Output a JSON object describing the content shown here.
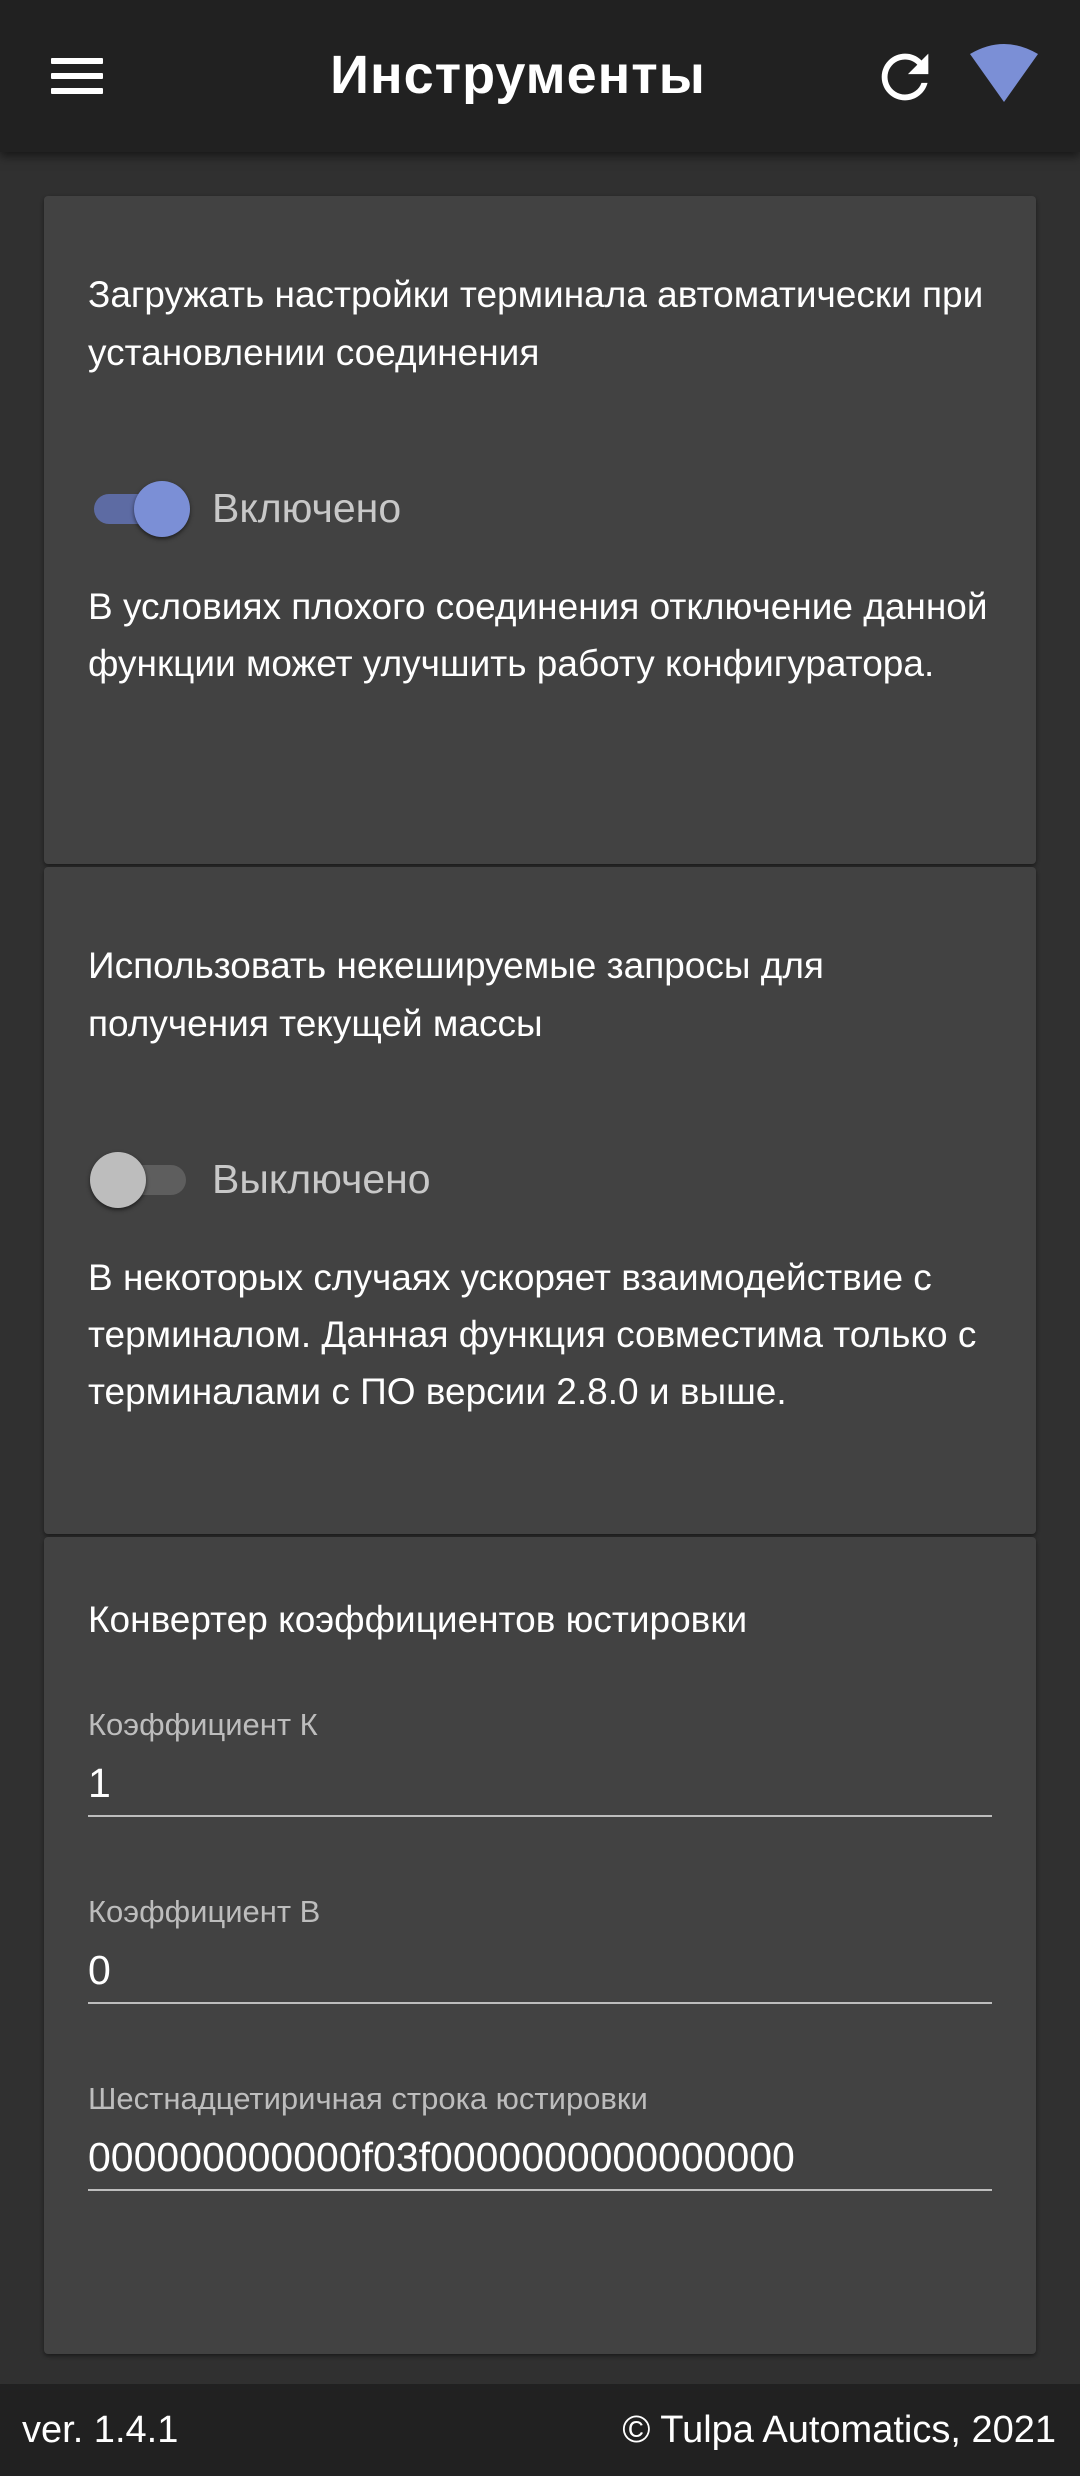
{
  "header": {
    "title": "Инструменты",
    "menu_icon": "menu-icon",
    "refresh_icon": "refresh-icon",
    "connection_icon": "wifi-icon",
    "accent_color": "#7b8fd6"
  },
  "settings": [
    {
      "title": "Загружать настройки терминала автоматически при установлении соединения",
      "enabled": true,
      "state_label": "Включено",
      "description": "В условиях плохого соединения отключение данной функции может улучшить работу конфигуратора."
    },
    {
      "title": "Использовать некешируемые запросы для получения текущей массы",
      "enabled": false,
      "state_label": "Выключено",
      "description": "В некоторых случаях ускоряет взаимодействие с терминалом. Данная функция совместима только с терминалами с ПО версии 2.8.0 и выше."
    }
  ],
  "converter": {
    "title": "Конвертер коэффициентов юстировки",
    "fields": [
      {
        "label": "Коэффициент К",
        "value": "1"
      },
      {
        "label": "Коэффициент В",
        "value": "0"
      },
      {
        "label": "Шестнадцетиричная строка юстировки",
        "value": "000000000000f03f0000000000000000"
      }
    ]
  },
  "footer": {
    "version": "ver. 1.4.1",
    "copyright": "© Tulpa Automatics, 2021"
  }
}
